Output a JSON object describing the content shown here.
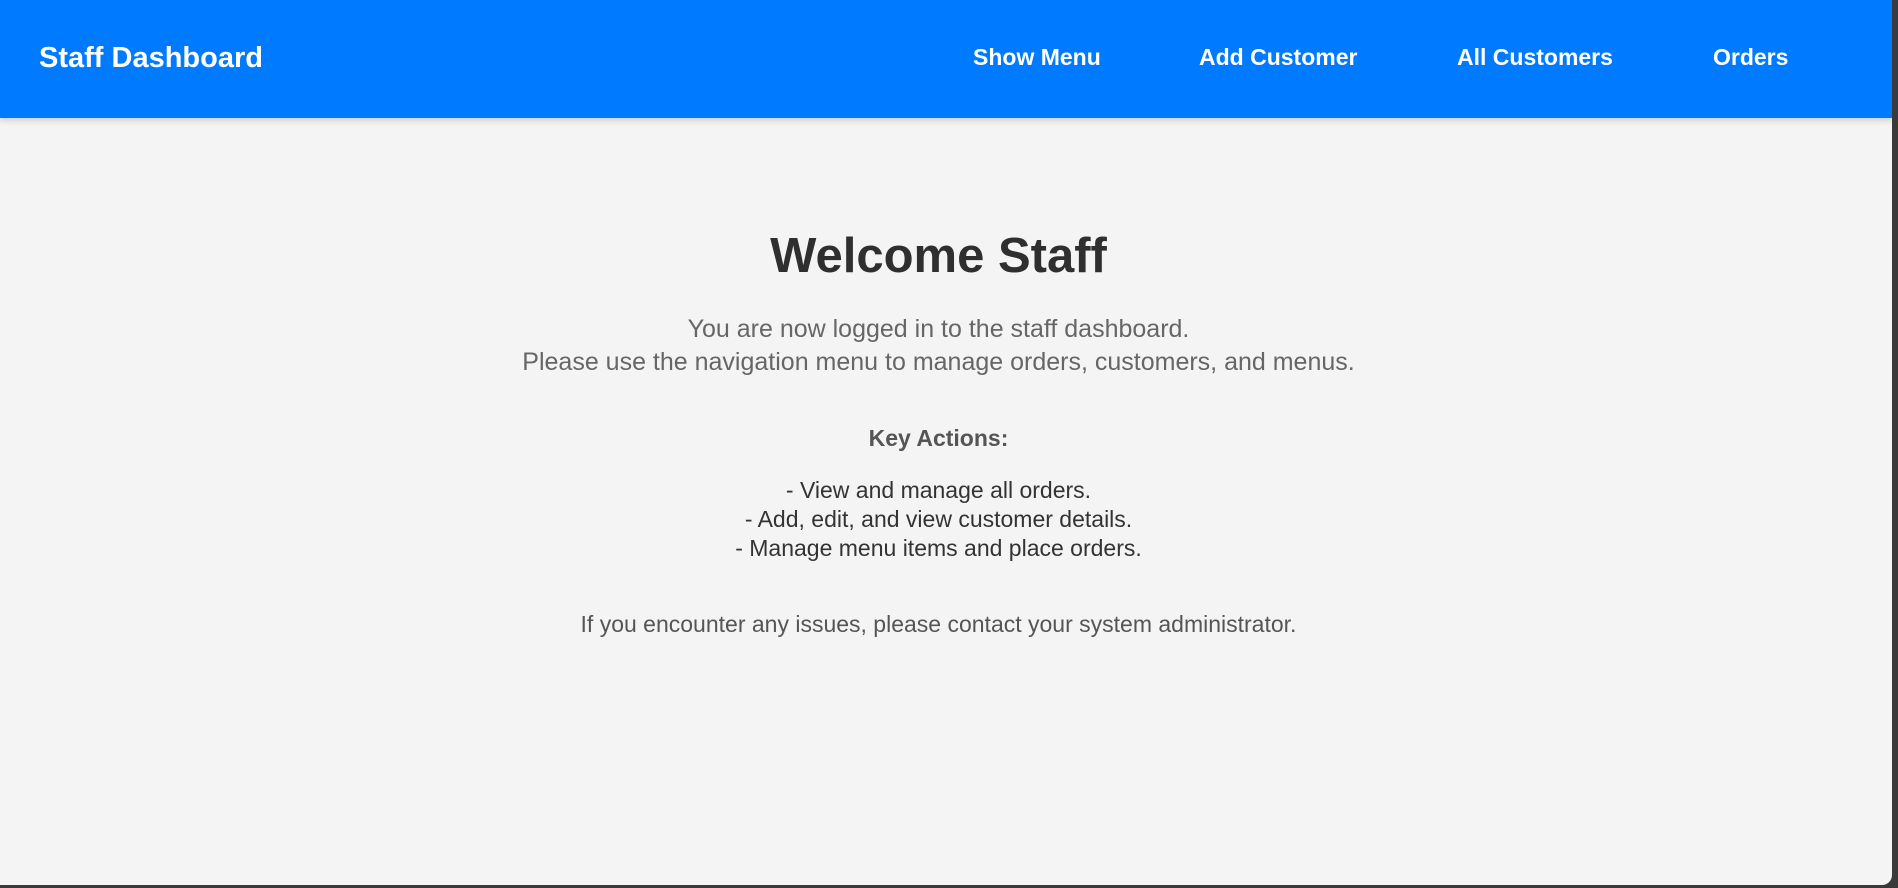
{
  "navbar": {
    "brand": "Staff Dashboard",
    "links": [
      {
        "label": "Show Menu"
      },
      {
        "label": "Add Customer"
      },
      {
        "label": "All Customers"
      },
      {
        "label": "Orders"
      }
    ],
    "background_color": "#007bff"
  },
  "main": {
    "title": "Welcome Staff",
    "intro": [
      "You are now logged in to the staff dashboard.",
      "Please use the navigation menu to manage orders, customers, and menus."
    ],
    "key_actions_title": "Key Actions:",
    "key_actions": [
      "- View and manage all orders.",
      "- Add, edit, and view customer details.",
      "- Manage menu items and place orders."
    ],
    "footer_note": "If you encounter any issues, please contact your system administrator.",
    "background_color": "#f4f4f4"
  }
}
